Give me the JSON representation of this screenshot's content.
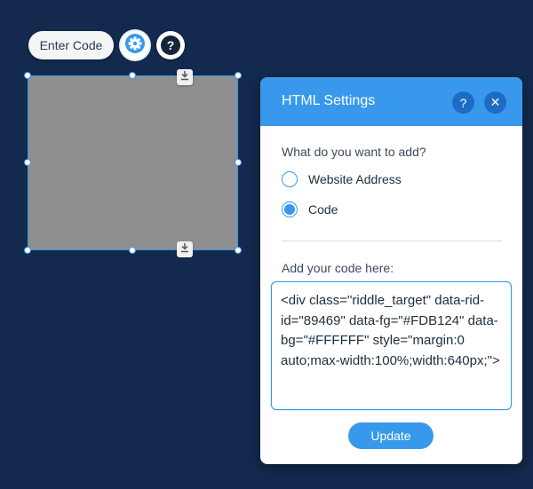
{
  "toolbar": {
    "enter_code_label": "Enter Code",
    "gear_icon": "gear-icon",
    "help_label": "?"
  },
  "element": {
    "fill_color": "#8f8f8f",
    "selection_color": "#3899ec",
    "anchor_icon": "download-anchor-icon"
  },
  "panel": {
    "title": "HTML Settings",
    "help_label": "?",
    "close_label": "✕",
    "header_color": "#3899ec",
    "question": "What do you want to add?",
    "options": [
      {
        "label": "Website Address",
        "selected": false
      },
      {
        "label": "Code",
        "selected": true
      }
    ],
    "code_label": "Add your code here:",
    "code_value": "<div class=\"riddle_target\" data-rid-id=\"89469\" data-fg=\"#FDB124\" data-bg=\"#FFFFFF\" style=\"margin:0 auto;max-width:100%;width:640px;\">",
    "update_label": "Update"
  },
  "background_color": "#132a4e"
}
